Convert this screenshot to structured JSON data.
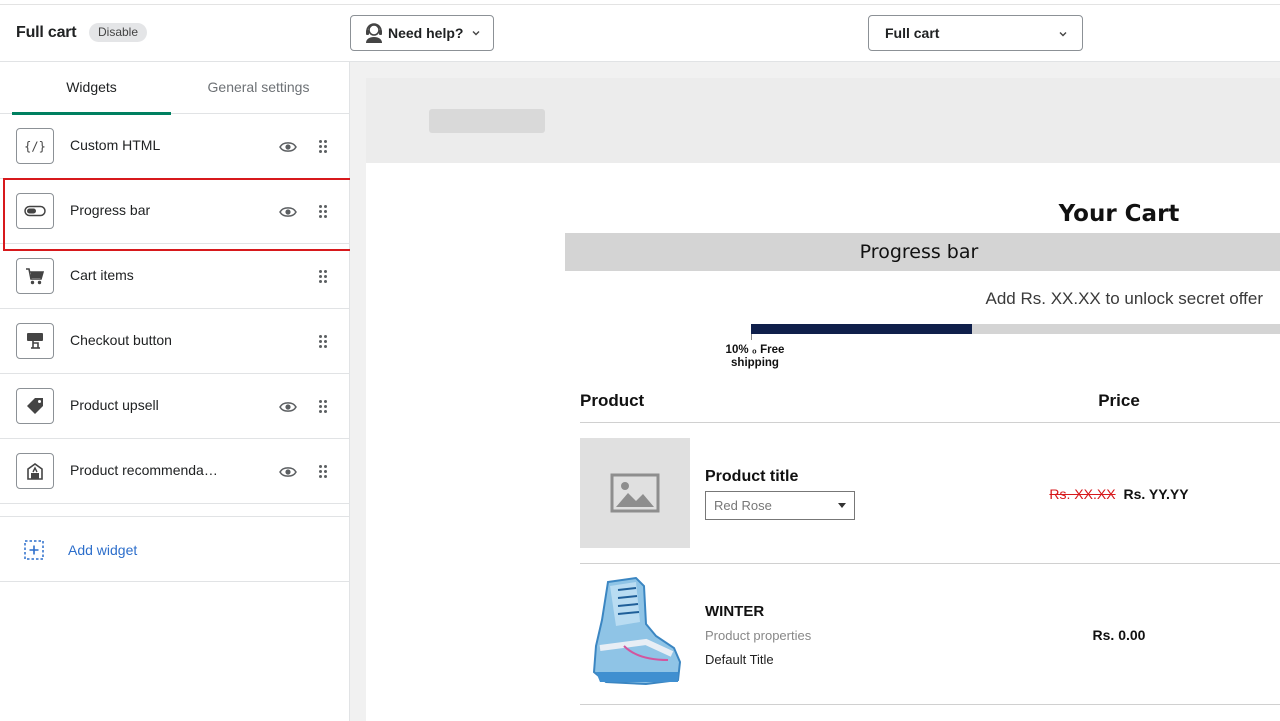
{
  "header": {
    "app_title": "Full cart",
    "status_badge": "Disable",
    "help_button": "Need help?",
    "view_select": "Full cart"
  },
  "sidebar": {
    "tabs": [
      {
        "label": "Widgets",
        "active": true
      },
      {
        "label": "General settings",
        "active": false
      }
    ],
    "widgets": [
      {
        "label": "Custom HTML",
        "icon": "code-icon",
        "visible_toggle": true
      },
      {
        "label": "Progress bar",
        "icon": "toggle-icon",
        "visible_toggle": true,
        "highlighted": true
      },
      {
        "label": "Cart items",
        "icon": "cart-icon",
        "visible_toggle": false
      },
      {
        "label": "Checkout button",
        "icon": "checkout-icon",
        "visible_toggle": false
      },
      {
        "label": "Product upsell",
        "icon": "tag-icon",
        "visible_toggle": true
      },
      {
        "label": "Product recommendat…",
        "icon": "recommendation-icon",
        "visible_toggle": true
      }
    ],
    "add_widget": "Add widget"
  },
  "preview": {
    "cart_title": "Your Cart",
    "progress_bar_label": "Progress bar",
    "unlock_message": "Add Rs. XX.XX to unlock secret offer",
    "progress_fraction": 0.418,
    "milestone": {
      "line1": "10%  ₀ Free",
      "line2": "shipping"
    },
    "table": {
      "col_product": "Product",
      "col_price": "Price"
    },
    "items": [
      {
        "title": "Product title",
        "variant": "Red Rose",
        "old_price": "Rs. XX.XX",
        "price": "Rs. YY.YY",
        "image": "placeholder-image-icon"
      },
      {
        "title": "WINTER",
        "properties": "Product properties",
        "variant": "Default Title",
        "price": "Rs. 0.00",
        "image": "snowboard-boot"
      }
    ]
  },
  "colors": {
    "accent_tab": "#008060",
    "progress_fill": "#0f1f4b",
    "highlight_border": "#d7191c",
    "link": "#2c6ecb",
    "old_price": "#d7191c"
  }
}
